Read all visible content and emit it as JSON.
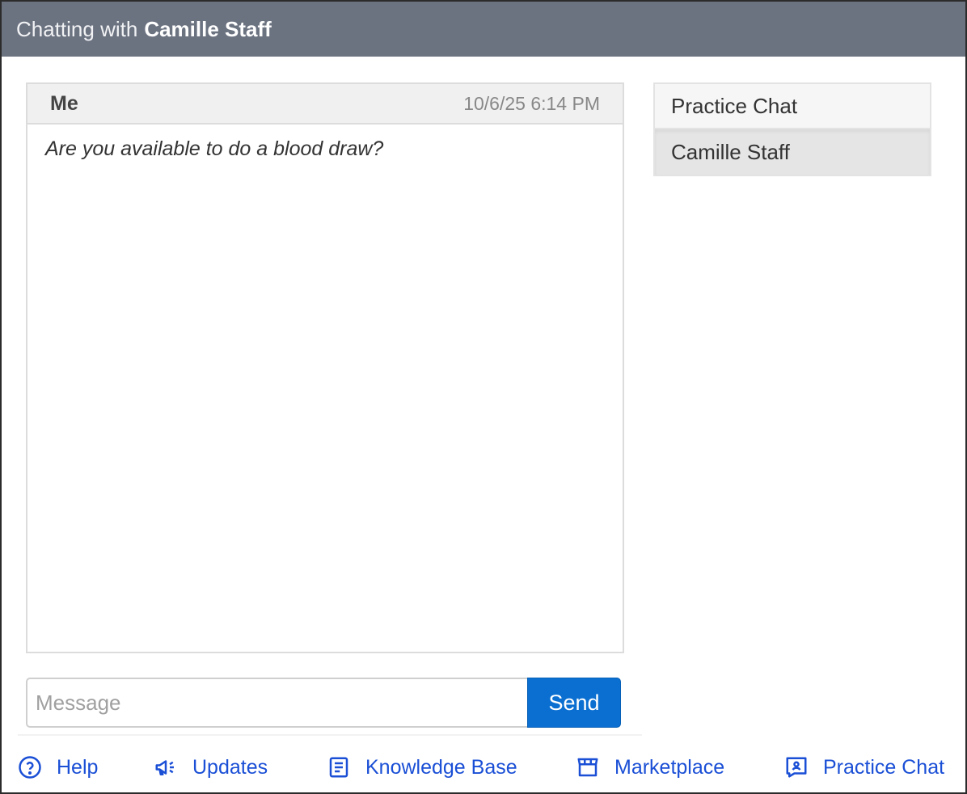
{
  "header": {
    "prefix": "Chatting with",
    "contact_name": "Camille Staff"
  },
  "message": {
    "sender": "Me",
    "timestamp": "10/6/25 6:14 PM",
    "text": "Are you available to do a blood draw?"
  },
  "conversations": [
    {
      "label": "Practice Chat",
      "selected": false
    },
    {
      "label": "Camille Staff",
      "selected": true
    }
  ],
  "composer": {
    "placeholder": "Message",
    "value": "",
    "send_label": "Send"
  },
  "footer": {
    "help": {
      "label": "Help",
      "icon": "help-circle-icon"
    },
    "updates": {
      "label": "Updates",
      "icon": "megaphone-icon"
    },
    "knowledge_base": {
      "label": "Knowledge Base",
      "icon": "document-icon"
    },
    "marketplace": {
      "label": "Marketplace",
      "icon": "storefront-icon"
    },
    "practice_chat": {
      "label": "Practice Chat",
      "icon": "contact-chat-icon"
    }
  },
  "colors": {
    "header_bg": "#6b7280",
    "accent": "#0a6fd1",
    "link": "#1a4fd6"
  }
}
